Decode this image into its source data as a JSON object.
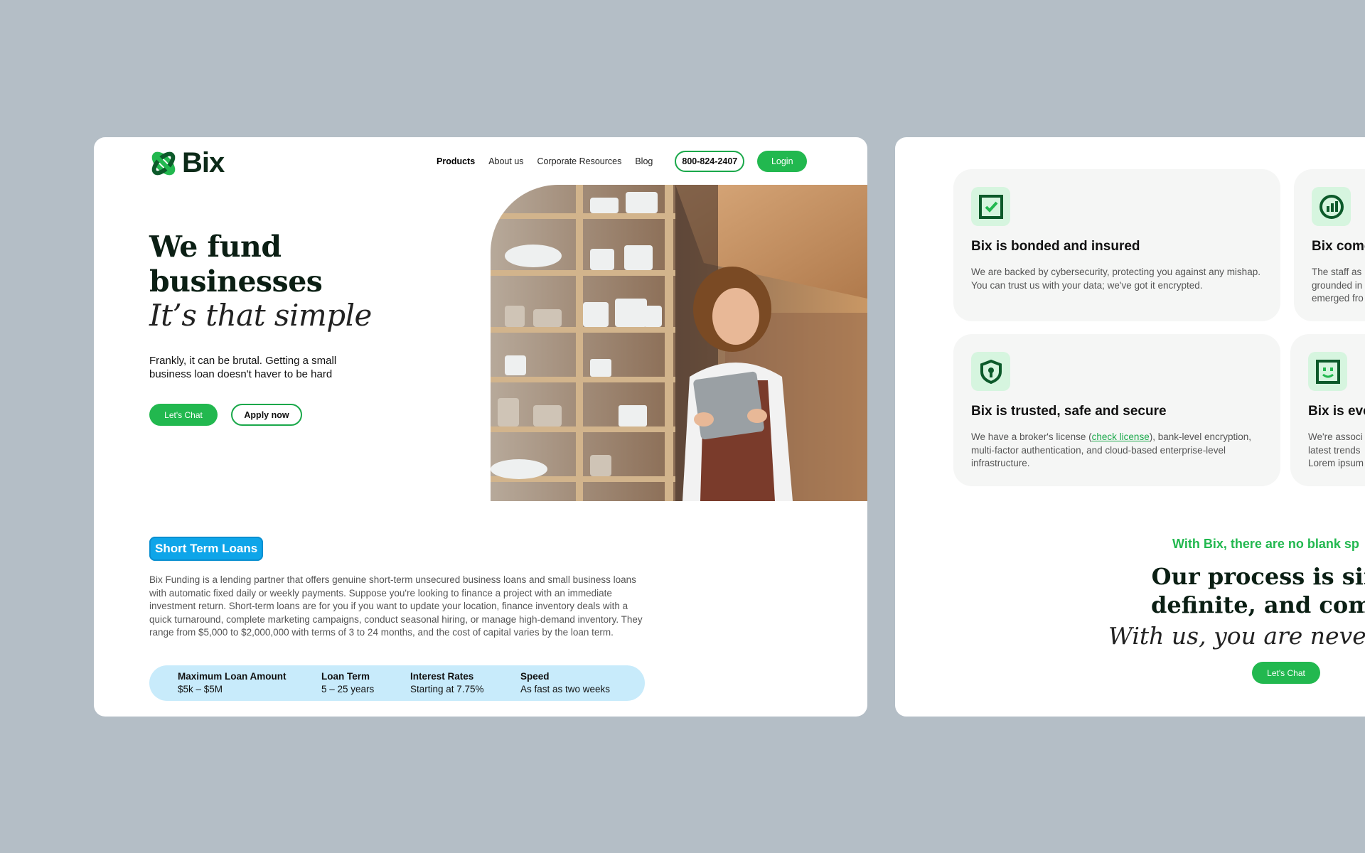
{
  "brand": {
    "name": "Bix",
    "primary_color": "#22b84f",
    "accent_blue": "#0ea5e9"
  },
  "nav": {
    "items": [
      {
        "label": "Products",
        "active": true
      },
      {
        "label": "About us"
      },
      {
        "label": "Corporate Resources"
      },
      {
        "label": "Blog"
      }
    ],
    "phone": "800-824-2407",
    "login": "Login"
  },
  "hero": {
    "title_line1": "We fund",
    "title_line2": "businesses",
    "subtitle": "It’s that simple",
    "description": "Frankly, it can be brutal.  Getting a small business loan doesn't haver to be hard",
    "cta_chat": "Let's Chat",
    "cta_apply": "Apply now"
  },
  "short_term": {
    "tag": "Short Term Loans",
    "description": "Bix Funding is a lending partner that offers genuine short-term unsecured business loans and small business loans with automatic fixed daily or weekly payments. Suppose you're looking to finance a project with an immediate investment return. Short-term loans are for you if you want to update your location, finance inventory deals with a quick turnaround, complete marketing campaigns, conduct seasonal hiring, or manage high-demand inventory. They range from $5,000 to $2,000,000 with terms of 3 to 24 months, and the cost of capital varies by the loan term.",
    "stats": [
      {
        "label": "Maximum Loan Amount",
        "value": "$5k – $5M"
      },
      {
        "label": "Loan Term",
        "value": "5 – 25 years"
      },
      {
        "label": "Interest Rates",
        "value": "Starting at 7.75%"
      },
      {
        "label": "Speed",
        "value": "As fast as two weeks"
      }
    ]
  },
  "features": [
    {
      "title": "Bix is bonded and insured",
      "description": "We are backed by cybersecurity, protecting you against any mishap. You can trust us with your data; we've got it encrypted.",
      "icon": "checkbox-icon"
    },
    {
      "title": "Bix come",
      "description_lines": [
        "The staff as",
        "grounded in",
        "emerged fro"
      ],
      "icon": "chart-icon"
    },
    {
      "title": "Bix is trusted, safe and secure",
      "description_before": "We have a broker's license (",
      "link": "check license",
      "description_after": "), bank-level encryption, multi-factor authentication, and cloud-based enterprise-level infrastructure.",
      "icon": "shield-icon"
    },
    {
      "title": "Bix is eve",
      "description_lines": [
        "We're associ",
        "latest trends",
        "Lorem ipsum"
      ],
      "icon": "smile-icon"
    }
  ],
  "process": {
    "eyebrow": "With Bix, there are no blank sp",
    "title_line1": "Our process is sim",
    "title_line2": "definite, and comp",
    "subtitle": "With us, you are never in",
    "cta": "Let's Chat"
  }
}
